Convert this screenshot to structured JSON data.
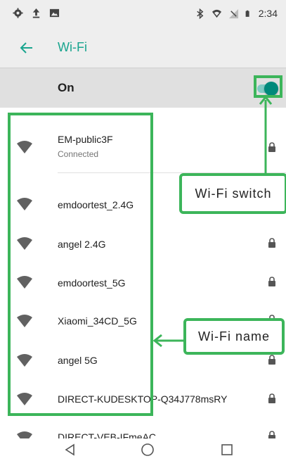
{
  "status_bar": {
    "left_icons": [
      "settings-icon",
      "upload-icon",
      "image-icon"
    ],
    "right_icons": [
      "bluetooth-icon",
      "wifi-signal-icon",
      "cellular-signal-icon",
      "battery-icon"
    ],
    "time": "2:34"
  },
  "app_bar": {
    "title": "Wi-Fi",
    "back_icon": "arrow-left-icon"
  },
  "wifi_toggle": {
    "label": "On",
    "state": true
  },
  "networks": [
    {
      "name": "EM-public3F",
      "status": "Connected",
      "secured": true
    },
    {
      "name": "emdoortest_2.4G",
      "secured": true
    },
    {
      "name": "angel 2.4G",
      "secured": true
    },
    {
      "name": "emdoortest_5G",
      "secured": true
    },
    {
      "name": "Xiaomi_34CD_5G",
      "secured": true
    },
    {
      "name": "angel 5G",
      "secured": true
    },
    {
      "name": "DIRECT-KUDESKTOP-Q34J778msRY",
      "secured": true
    },
    {
      "name": "DIRECT-VEB-IFmeAC",
      "secured": true
    }
  ],
  "annotations": {
    "switch_label": "Wi-Fi switch",
    "name_label": "Wi-Fi name"
  },
  "nav_bar": {
    "back": "back-triangle-icon",
    "home": "home-circle-icon",
    "recents": "recents-square-icon"
  },
  "colors": {
    "accent": "#1aa58f",
    "annotation": "#3cb55a",
    "toggle_thumb": "#00897b"
  }
}
